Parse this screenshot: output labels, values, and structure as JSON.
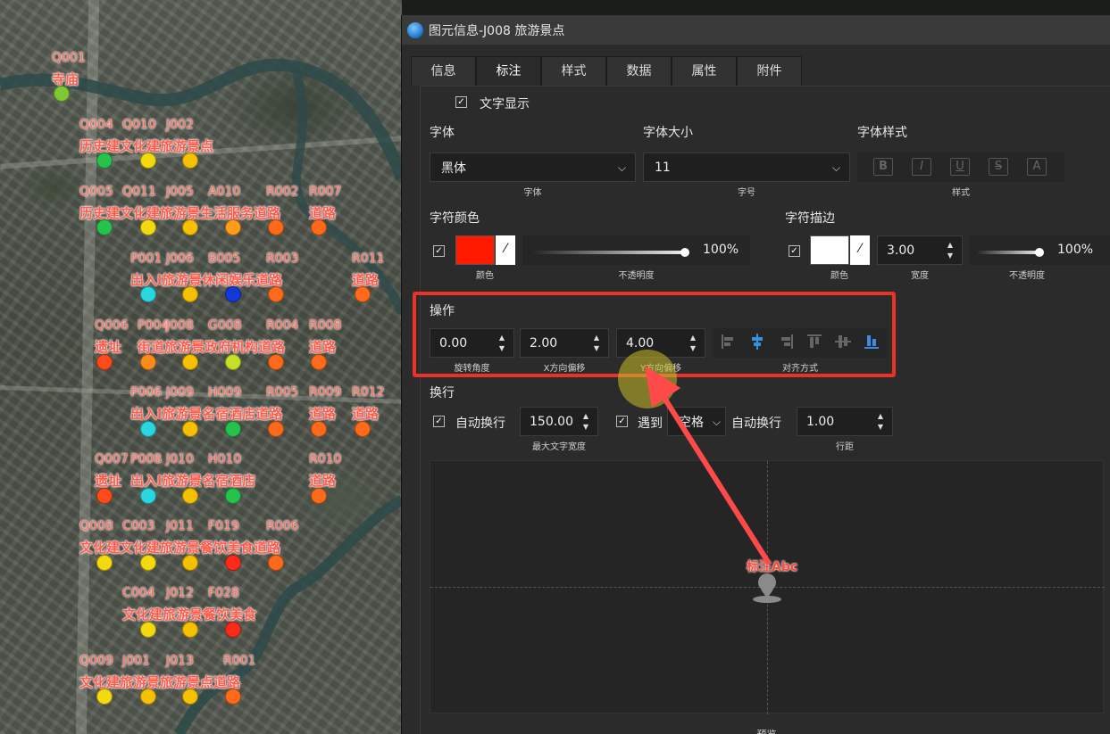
{
  "window": {
    "title": "图元信息-J008 旅游景点"
  },
  "tabs": [
    {
      "label": "信息"
    },
    {
      "label": "标注"
    },
    {
      "label": "样式"
    },
    {
      "label": "数据"
    },
    {
      "label": "属性"
    },
    {
      "label": "附件"
    }
  ],
  "text_display": {
    "label": "文字显示",
    "checked": true
  },
  "font": {
    "label": "字体",
    "value": "黑体",
    "caption": "字体",
    "size_label": "字体大小",
    "size_value": "11",
    "size_caption": "字号",
    "style_label": "字体样式",
    "style_caption": "样式",
    "style_buttons": [
      "B",
      "I",
      "U",
      "S",
      "A"
    ]
  },
  "char_color": {
    "label": "字符颜色",
    "color": "#ff1a00",
    "color_caption": "颜色",
    "opacity_value": "100%",
    "opacity_caption": "不透明度"
  },
  "stroke": {
    "label": "字符描边",
    "color": "#ffffff",
    "color_caption": "颜色",
    "width_value": "3.00",
    "width_caption": "宽度",
    "opacity_value": "100%",
    "opacity_caption": "不透明度"
  },
  "operation": {
    "label": "操作",
    "rotation": "0.00",
    "rotation_caption": "旋转角度",
    "x_offset": "2.00",
    "x_offset_caption": "X方向偏移",
    "y_offset": "4.00",
    "y_offset_caption": "Y方向偏移",
    "align_caption": "对齐方式"
  },
  "wrap": {
    "label": "换行",
    "auto_wrap_label": "自动换行",
    "max_width": "150.00",
    "max_width_caption": "最大文字宽度",
    "meet_label": "遇到",
    "meet_value": "空格",
    "auto_wrap_label2": "自动换行",
    "line_spacing": "1.00",
    "line_spacing_caption": "行距"
  },
  "preview": {
    "sample_text": "标注Abc",
    "caption": "预览"
  },
  "colors": {
    "accent_red": "#e8332a",
    "check_blue": "#3b8de0"
  },
  "map": {
    "pois": [
      {
        "code": "Q001",
        "label": "寺庙",
        "color": "#7ec832"
      },
      {
        "code": "Q004",
        "color": "#27c24c"
      },
      {
        "code": "Q010",
        "color": "#f5d90f"
      },
      {
        "code": "J002",
        "color": "#f5c000"
      },
      {
        "code": "Q005",
        "color": "#27c24c"
      },
      {
        "code": "Q011",
        "color": "#f5d90f"
      },
      {
        "code": "J005",
        "color": "#f5c000"
      },
      {
        "code": "A010",
        "color": "#ff9c1a"
      },
      {
        "code": "R002",
        "color": "#ff6a1a"
      },
      {
        "code": "R007",
        "color": "#ff6a1a"
      },
      {
        "code": "P001",
        "color": "#2ad6e0"
      },
      {
        "code": "J006",
        "color": "#f5c000"
      },
      {
        "code": "B005",
        "color": "#1238d8"
      },
      {
        "code": "R003",
        "color": "#ff6a1a"
      },
      {
        "code": "R011",
        "color": "#ff6a1a"
      },
      {
        "code": "Q006",
        "color": "#ff4a1a"
      },
      {
        "code": "P004",
        "color": "#ff8a1a"
      },
      {
        "code": "J008",
        "color": "#f5c000"
      },
      {
        "code": "G008",
        "color": "#c6e02a"
      },
      {
        "code": "R004",
        "color": "#ff6a1a"
      },
      {
        "code": "R008",
        "color": "#ff6a1a"
      },
      {
        "code": "P006",
        "color": "#2ad6e0"
      },
      {
        "code": "J009",
        "color": "#f5c000"
      },
      {
        "code": "H009",
        "color": "#27c24c"
      },
      {
        "code": "R005",
        "color": "#ff6a1a"
      },
      {
        "code": "R009",
        "color": "#ff6a1a"
      },
      {
        "code": "R012",
        "color": "#ff6a1a"
      },
      {
        "code": "Q007",
        "color": "#ff4a1a"
      },
      {
        "code": "P008",
        "color": "#2ad6e0"
      },
      {
        "code": "J010",
        "color": "#f5c000"
      },
      {
        "code": "H010",
        "color": "#27c24c"
      },
      {
        "code": "R010",
        "color": "#ff6a1a"
      },
      {
        "code": "Q008",
        "color": "#f5d90f"
      },
      {
        "code": "C003",
        "color": "#f5d90f"
      },
      {
        "code": "J011",
        "color": "#f5c000"
      },
      {
        "code": "F019",
        "color": "#ff2a1a"
      },
      {
        "code": "R006",
        "color": "#ff6a1a"
      },
      {
        "code": "C004",
        "color": "#f5d90f"
      },
      {
        "code": "J012",
        "color": "#f5c000"
      },
      {
        "code": "F028",
        "color": "#ff2a1a"
      },
      {
        "code": "Q009",
        "color": "#f5d90f"
      },
      {
        "code": "J001",
        "color": "#f5c000"
      },
      {
        "code": "J013",
        "color": "#f5c000"
      },
      {
        "code": "R001",
        "color": "#ff6a1a"
      }
    ],
    "row_labels": [
      "历史建文化建旅游景点",
      "历史建文化建旅游景生活服务道路",
      "出入l旅游景休闲娱乐道路",
      "遗址",
      "街道旅游景政府机构道路",
      "道路",
      "出入l旅游景名宿酒店道路",
      "遗址",
      "出入l旅游景名宿酒店",
      "道路",
      "文化建文化建旅游景餐饮美食道路",
      "文化建旅游景餐饮美食",
      "文化建旅游景旅游景点道路",
      "道路",
      "道路",
      "道路",
      "道路"
    ]
  }
}
